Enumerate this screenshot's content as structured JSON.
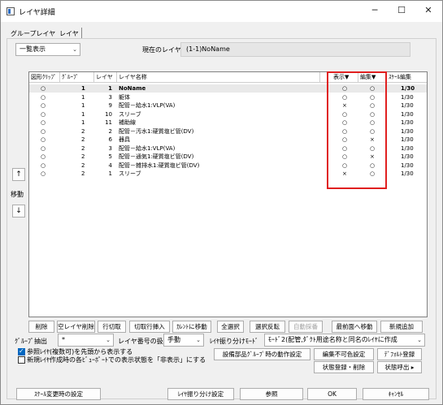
{
  "window": {
    "title": "レイヤ詳細",
    "minimize": "─",
    "maximize": "☐",
    "close": "✕"
  },
  "tabs": [
    {
      "label": "グループレイヤ"
    },
    {
      "label": "レイヤ"
    }
  ],
  "view_select": {
    "value": "一覧表示"
  },
  "current_layer": {
    "label": "現在のレイヤ",
    "value": "(1-1)NoName"
  },
  "grid": {
    "columns": [
      "図形ｸﾘｯﾌﾟ",
      "ｸﾞﾙｰﾌﾟ",
      "レイヤ",
      "レイヤ名称",
      "表示▼",
      "編集▼",
      "ｽｹｰﾙ編集"
    ],
    "rows": [
      {
        "clip": "○",
        "group": "1",
        "layer": "1",
        "name": "NoName",
        "show": "○",
        "edit": "○",
        "scale": "1/30",
        "bold": true
      },
      {
        "clip": "○",
        "group": "1",
        "layer": "3",
        "name": "躯体",
        "show": "○",
        "edit": "○",
        "scale": "1/30"
      },
      {
        "clip": "○",
        "group": "1",
        "layer": "9",
        "name": "配管－給水1:VLP(VA)",
        "show": "×",
        "edit": "○",
        "scale": "1/30"
      },
      {
        "clip": "○",
        "group": "1",
        "layer": "10",
        "name": "スリーブ",
        "show": "○",
        "edit": "○",
        "scale": "1/30"
      },
      {
        "clip": "○",
        "group": "1",
        "layer": "11",
        "name": "補助線",
        "show": "○",
        "edit": "○",
        "scale": "1/30"
      },
      {
        "clip": "○",
        "group": "2",
        "layer": "2",
        "name": "配管－汚水1:硬質塩ビ管(DV)",
        "show": "○",
        "edit": "○",
        "scale": "1/30"
      },
      {
        "clip": "○",
        "group": "2",
        "layer": "6",
        "name": "器具",
        "show": "○",
        "edit": "×",
        "scale": "1/30"
      },
      {
        "clip": "○",
        "group": "2",
        "layer": "3",
        "name": "配管－給水1:VLP(VA)",
        "show": "○",
        "edit": "○",
        "scale": "1/30"
      },
      {
        "clip": "○",
        "group": "2",
        "layer": "5",
        "name": "配管－通気1:硬質塩ビ管(DV)",
        "show": "○",
        "edit": "×",
        "scale": "1/30"
      },
      {
        "clip": "○",
        "group": "2",
        "layer": "4",
        "name": "配管－雑排水1:硬質塩ビ管(DV)",
        "show": "○",
        "edit": "○",
        "scale": "1/30"
      },
      {
        "clip": "○",
        "group": "2",
        "layer": "1",
        "name": "スリーブ",
        "show": "×",
        "edit": "○",
        "scale": "1/30"
      }
    ]
  },
  "side": {
    "up": "↑",
    "move_label": "移動",
    "down": "↓"
  },
  "buttons_row1": [
    "削除",
    "空レイヤ削除",
    "行切取",
    "切取行挿入",
    "ｶﾚﾝﾄに移動",
    "全選択",
    "選択反転",
    "自動採番",
    "最前面へ移動",
    "新規追加"
  ],
  "group_extract": {
    "label": "ｸﾞﾙｰﾌﾟ抽出",
    "value": "*"
  },
  "layer_number": {
    "label": "レイヤ番号の扱い",
    "value": "手動"
  },
  "layer_split_mode": {
    "label": "ﾚｲﾔ振り分けﾓｰﾄﾞ",
    "value": "ﾓｰﾄﾞ2(配管,ﾀﾞｸﾄ用途名称と同名のﾚｲﾔに作成"
  },
  "checks": [
    {
      "label": "参照ﾚｲﾔ(複数可)を先頭から表示する",
      "checked": true
    },
    {
      "label": "新規ﾚｲﾔ作成時の各ﾋﾞｭｰﾎﾟｰﾄでの表示状態を「非表示」にする",
      "checked": false
    }
  ],
  "buttons_mid": {
    "equip_group": "設備部品ｸﾞﾙｰﾌﾟ時の動作設定",
    "no_edit_color": "編集不可色設定",
    "default_register": "ﾃﾞﾌｫﾙﾄ登録",
    "state_register": "状態登録・削除",
    "state_call": "状態呼出 ▸"
  },
  "buttons_bottom": {
    "scale_change": "ｽｹｰﾙ変更時の設定",
    "layer_split": "ﾚｲﾔ振り分け設定",
    "reference": "参照",
    "ok": "OK",
    "cancel": "ｷｬﾝｾﾙ"
  },
  "colors": {
    "highlight_box": "#e02020"
  }
}
